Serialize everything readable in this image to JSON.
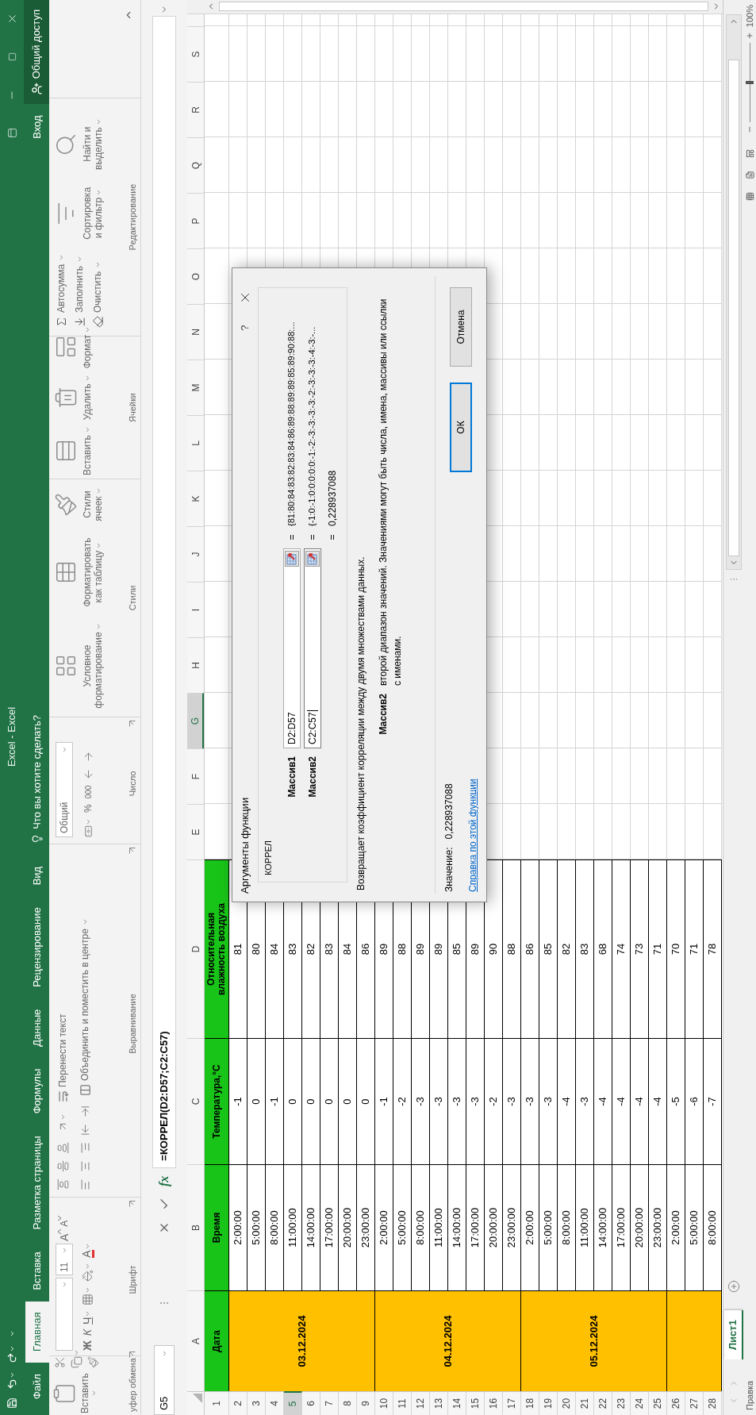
{
  "title_bar": {
    "title": "Excel - Excel"
  },
  "tabs": [
    {
      "label": "Файл",
      "selected": false
    },
    {
      "label": "Главная",
      "selected": true
    },
    {
      "label": "Вставка",
      "selected": false
    },
    {
      "label": "Разметка страницы",
      "selected": false
    },
    {
      "label": "Формулы",
      "selected": false
    },
    {
      "label": "Данные",
      "selected": false
    },
    {
      "label": "Рецензирование",
      "selected": false
    },
    {
      "label": "Вид",
      "selected": false
    }
  ],
  "tell_me": "Что вы хотите сделать?",
  "sign_in": "Вход",
  "share": "Общий доступ",
  "ribbon": [
    {
      "kind": "clipboard",
      "label": "уфер обмена",
      "paste": "Вставить"
    },
    {
      "kind": "font",
      "label": "Шрифт",
      "font_size": "11",
      "grow": "A",
      "shrink": "A",
      "bold": "Ж",
      "italic": "К",
      "underline": "Ч",
      "font_color": "A"
    },
    {
      "kind": "alignment",
      "label": "Выравнивание",
      "wrap": "Перенести текст",
      "merge": "Объединить и поместить в центре"
    },
    {
      "kind": "number",
      "label": "Число",
      "format": "Общий",
      "percent": "%",
      "thousands": "000"
    },
    {
      "kind": "styles",
      "label": "Стили",
      "buttons": [
        {
          "lines": [
            "Условное",
            "форматирование"
          ]
        },
        {
          "lines": [
            "Форматировать",
            "как таблицу"
          ]
        },
        {
          "lines": [
            "Стили",
            "ячеек"
          ]
        }
      ]
    },
    {
      "kind": "cells",
      "label": "Ячейки",
      "buttons": [
        {
          "lines": [
            "Вставить"
          ]
        },
        {
          "lines": [
            "Удалить"
          ]
        },
        {
          "lines": [
            "Формат"
          ]
        }
      ]
    },
    {
      "kind": "editing",
      "label": "Редактирование",
      "items": [
        "Автосумма",
        "Заполнить",
        "Очистить"
      ],
      "buttons": [
        {
          "lines": [
            "Сортировка",
            "и фильтр"
          ]
        },
        {
          "lines": [
            "Найти и",
            "выделить"
          ]
        }
      ]
    }
  ],
  "formula_bar": {
    "name_box": "G5",
    "fx": "fx",
    "formula": "=КОРРЕЛ(D2:D57;C2:C57)"
  },
  "sheet": {
    "columns": [
      {
        "label": "A",
        "selected": false
      },
      {
        "label": "B",
        "selected": false
      },
      {
        "label": "C",
        "selected": false
      },
      {
        "label": "D",
        "selected": false
      },
      {
        "label": "E",
        "selected": false
      },
      {
        "label": "F",
        "selected": false
      },
      {
        "label": "G",
        "selected": true
      },
      {
        "label": "H",
        "selected": false
      },
      {
        "label": "I",
        "selected": false
      },
      {
        "label": "J",
        "selected": false
      },
      {
        "label": "K",
        "selected": false
      },
      {
        "label": "L",
        "selected": false
      },
      {
        "label": "M",
        "selected": false
      },
      {
        "label": "N",
        "selected": false
      },
      {
        "label": "O",
        "selected": false
      },
      {
        "label": "P",
        "selected": false
      },
      {
        "label": "Q",
        "selected": false
      },
      {
        "label": "R",
        "selected": false
      },
      {
        "label": "S",
        "selected": false
      }
    ],
    "header_row": {
      "number": "1",
      "selected": false,
      "cells": [
        "Дата",
        "Время",
        "Температура,°C",
        "Относительная влажность воздуха"
      ]
    },
    "days": [
      {
        "date": "03.12.2024",
        "rows": [
          {
            "number": "2",
            "selected": false,
            "time": "2:00:00",
            "temp": "-1",
            "humidity": "81"
          },
          {
            "number": "3",
            "selected": false,
            "time": "5:00:00",
            "temp": "0",
            "humidity": "80"
          },
          {
            "number": "4",
            "selected": false,
            "time": "8:00:00",
            "temp": "-1",
            "humidity": "84"
          },
          {
            "number": "5",
            "selected": true,
            "time": "11:00:00",
            "temp": "0",
            "humidity": "83"
          },
          {
            "number": "6",
            "selected": false,
            "time": "14:00:00",
            "temp": "0",
            "humidity": "82"
          },
          {
            "number": "7",
            "selected": false,
            "time": "17:00:00",
            "temp": "0",
            "humidity": "83"
          },
          {
            "number": "8",
            "selected": false,
            "time": "20:00:00",
            "temp": "0",
            "humidity": "84"
          },
          {
            "number": "9",
            "selected": false,
            "time": "23:00:00",
            "temp": "0",
            "humidity": "86"
          }
        ]
      },
      {
        "date": "04.12.2024",
        "rows": [
          {
            "number": "10",
            "selected": false,
            "time": "2:00:00",
            "temp": "-1",
            "humidity": "89"
          },
          {
            "number": "11",
            "selected": false,
            "time": "5:00:00",
            "temp": "-2",
            "humidity": "88"
          },
          {
            "number": "12",
            "selected": false,
            "time": "8:00:00",
            "temp": "-3",
            "humidity": "89"
          },
          {
            "number": "13",
            "selected": false,
            "time": "11:00:00",
            "temp": "-3",
            "humidity": "89"
          },
          {
            "number": "14",
            "selected": false,
            "time": "14:00:00",
            "temp": "-3",
            "humidity": "85"
          },
          {
            "number": "15",
            "selected": false,
            "time": "17:00:00",
            "temp": "-3",
            "humidity": "89"
          },
          {
            "number": "16",
            "selected": false,
            "time": "20:00:00",
            "temp": "-2",
            "humidity": "90"
          },
          {
            "number": "17",
            "selected": false,
            "time": "23:00:00",
            "temp": "-3",
            "humidity": "88"
          }
        ]
      },
      {
        "date": "05.12.2024",
        "rows": [
          {
            "number": "18",
            "selected": false,
            "time": "2:00:00",
            "temp": "-3",
            "humidity": "86"
          },
          {
            "number": "19",
            "selected": false,
            "time": "5:00:00",
            "temp": "-3",
            "humidity": "85"
          },
          {
            "number": "20",
            "selected": false,
            "time": "8:00:00",
            "temp": "-4",
            "humidity": "82"
          },
          {
            "number": "21",
            "selected": false,
            "time": "11:00:00",
            "temp": "-3",
            "humidity": "83"
          },
          {
            "number": "22",
            "selected": false,
            "time": "14:00:00",
            "temp": "-4",
            "humidity": "68"
          },
          {
            "number": "23",
            "selected": false,
            "time": "17:00:00",
            "temp": "-4",
            "humidity": "74"
          },
          {
            "number": "24",
            "selected": false,
            "time": "20:00:00",
            "temp": "-4",
            "humidity": "73"
          },
          {
            "number": "25",
            "selected": false,
            "time": "23:00:00",
            "temp": "-4",
            "humidity": "71"
          }
        ]
      },
      {
        "rows": [
          {
            "number": "26",
            "selected": false,
            "time": "2:00:00",
            "temp": "-5",
            "humidity": "70"
          },
          {
            "number": "27",
            "selected": false,
            "time": "5:00:00",
            "temp": "-6",
            "humidity": "71"
          },
          {
            "number": "28",
            "selected": false,
            "time": "8:00:00",
            "temp": "-7",
            "humidity": "78"
          }
        ]
      }
    ]
  },
  "dialog": {
    "title": "Аргументы функции",
    "help": "?",
    "function": "КОРРЕЛ",
    "args": [
      {
        "label": "Массив1",
        "value": "D2:D57",
        "equals": "=",
        "result": "{81:80:84:83:82:83:84:86:89:88:89:89:85:89:90:88:...",
        "focused": false
      },
      {
        "label": "Массив2",
        "value": "C2:C57",
        "equals": "=",
        "result": "{-1:0:-1:0:0:0:0:0:-1:-2:-3:-3:-3:-3:-2:-3:-3:-3:-4:-3:-...",
        "focused": true
      }
    ],
    "formula_equals": "=",
    "formula_result": "0,228937088",
    "description": "Возвращает коэффициент корреляции между двумя множествами данных.",
    "arg_help_label": "Массив2",
    "arg_help": "второй диапазон значений. Значениями могут быть числа, имена, массивы или ссылки с именами.",
    "value_label": "Значение:",
    "value": "0,228937088",
    "help_link": "Справка по этой функции",
    "ok": "ОК",
    "cancel": "Отмена"
  },
  "sheet_tabs": [
    {
      "label": "Лист1",
      "selected": true
    }
  ],
  "status_bar": {
    "mode": "Правка",
    "zoom": {
      "level": 0.5,
      "reading": "100%"
    }
  }
}
